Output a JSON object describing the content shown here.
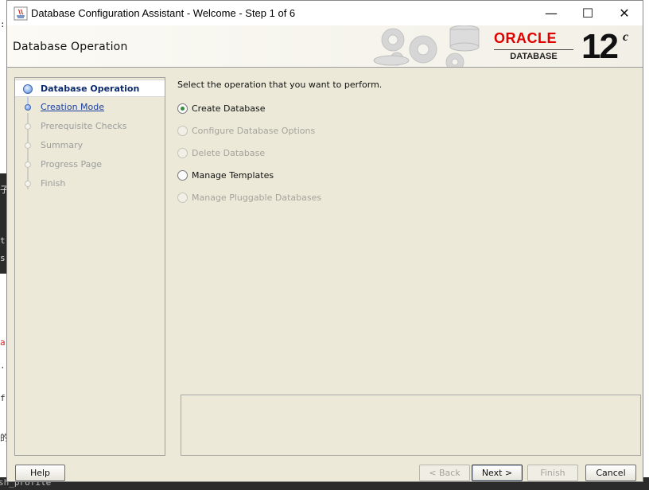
{
  "window": {
    "title": "Database Configuration Assistant - Welcome - Step 1 of 6",
    "minimize_glyph": "—",
    "maximize_glyph": "☐",
    "close_glyph": "✕"
  },
  "header": {
    "page_title": "Database Operation",
    "brand_word": "ORACLE",
    "brand_sub": "DATABASE",
    "version": "12",
    "version_suffix": "c"
  },
  "steps": [
    {
      "label": "Database Operation",
      "state": "current"
    },
    {
      "label": "Creation Mode",
      "state": "link"
    },
    {
      "label": "Prerequisite Checks",
      "state": "disabled"
    },
    {
      "label": "Summary",
      "state": "disabled"
    },
    {
      "label": "Progress Page",
      "state": "disabled"
    },
    {
      "label": "Finish",
      "state": "disabled"
    }
  ],
  "main": {
    "instruction": "Select the operation that you want to perform.",
    "options": [
      {
        "label": "Create Database",
        "checked": true,
        "enabled": true
      },
      {
        "label": "Configure Database Options",
        "checked": false,
        "enabled": false
      },
      {
        "label": "Delete Database",
        "checked": false,
        "enabled": false
      },
      {
        "label": "Manage Templates",
        "checked": false,
        "enabled": true
      },
      {
        "label": "Manage Pluggable Databases",
        "checked": false,
        "enabled": false
      }
    ]
  },
  "footer": {
    "help": "Help",
    "back": "< Back",
    "next": "Next >",
    "finish": "Finish",
    "cancel": "Cancel"
  },
  "colors": {
    "oracle_red": "#e00000",
    "panel_bg": "#ece9d8",
    "link_blue": "#1a3fa0",
    "selected_radio": "#2f8f3a"
  },
  "background_fragments": {
    "chars": [
      ":",
      "子",
      "t",
      "s",
      "a",
      "·",
      "f",
      "的"
    ],
    "bottom_text": "sh_profile"
  }
}
